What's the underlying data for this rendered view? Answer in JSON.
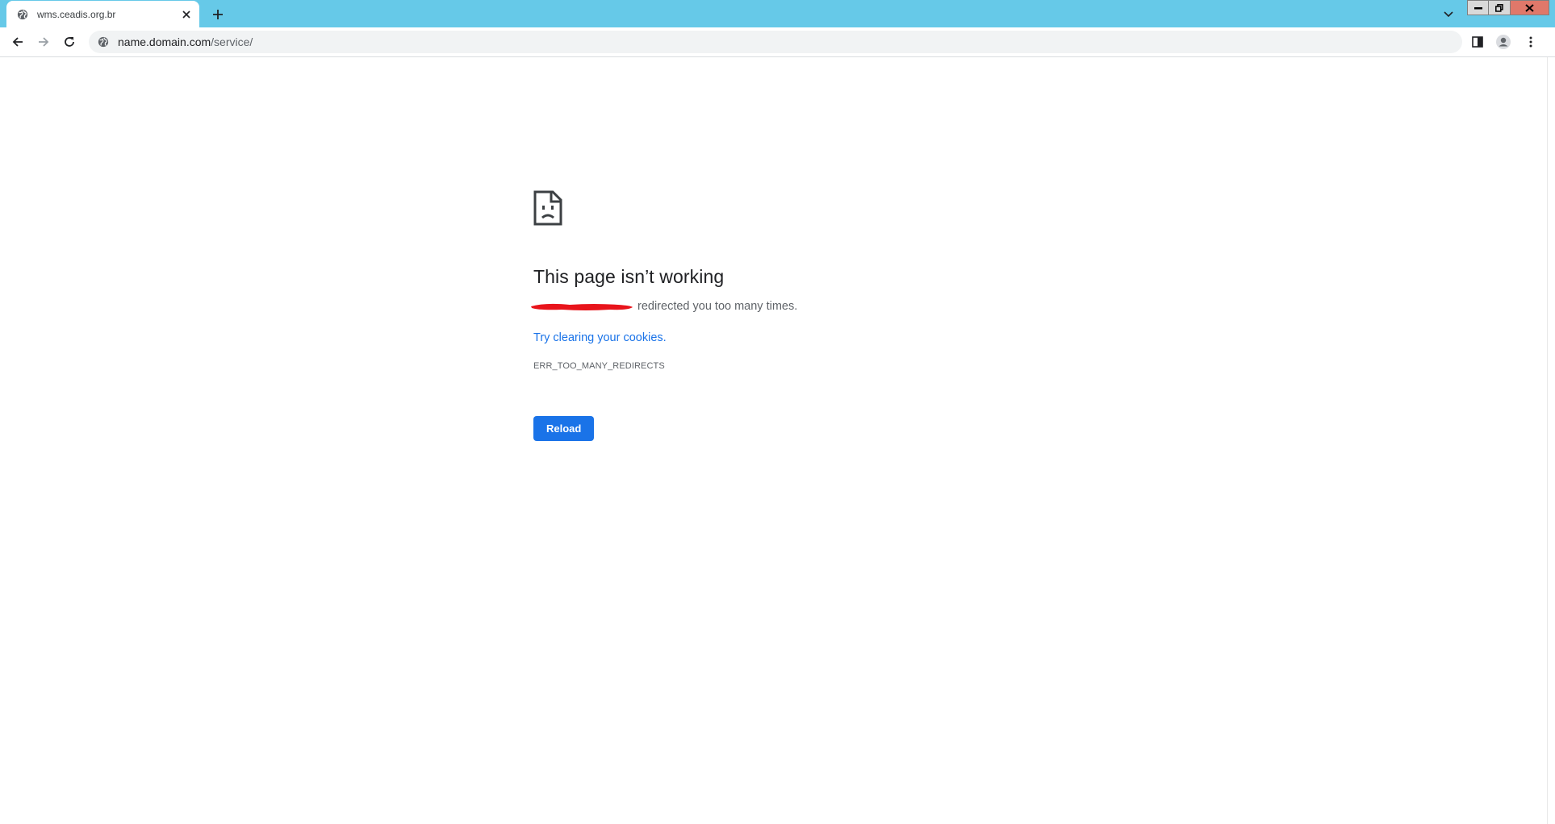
{
  "browser": {
    "tab": {
      "title": "wms.ceadis.org.br",
      "favicon": "globe-icon",
      "close_icon": "close-icon"
    },
    "new_tab_icon": "plus-icon",
    "tab_search_icon": "chevron-down-icon",
    "window_controls": {
      "minimize": "minimize-icon",
      "maximize": "restore-icon",
      "close": "close-icon"
    },
    "toolbar": {
      "back_icon": "back-arrow-icon",
      "forward_icon": "forward-arrow-icon",
      "reload_icon": "reload-icon",
      "address": {
        "host": "name.domain.com",
        "path": "/service/",
        "site_info_icon": "globe-icon"
      },
      "side_panel_icon": "side-panel-icon",
      "profile_icon": "profile-icon",
      "menu_icon": "kebab-menu-icon"
    },
    "colors": {
      "tabstrip": "#66c9e8",
      "accent": "#1a73e8",
      "window_close": "#e0786a"
    }
  },
  "error_page": {
    "icon": "sad-document-icon",
    "heading": "This page isn’t working",
    "summary": "redirected you too many times.",
    "redaction_color": "#e8141b",
    "suggestion_link": "Try clearing your cookies",
    "suggestion_suffix": ".",
    "error_code": "ERR_TOO_MANY_REDIRECTS",
    "reload_button": "Reload"
  }
}
